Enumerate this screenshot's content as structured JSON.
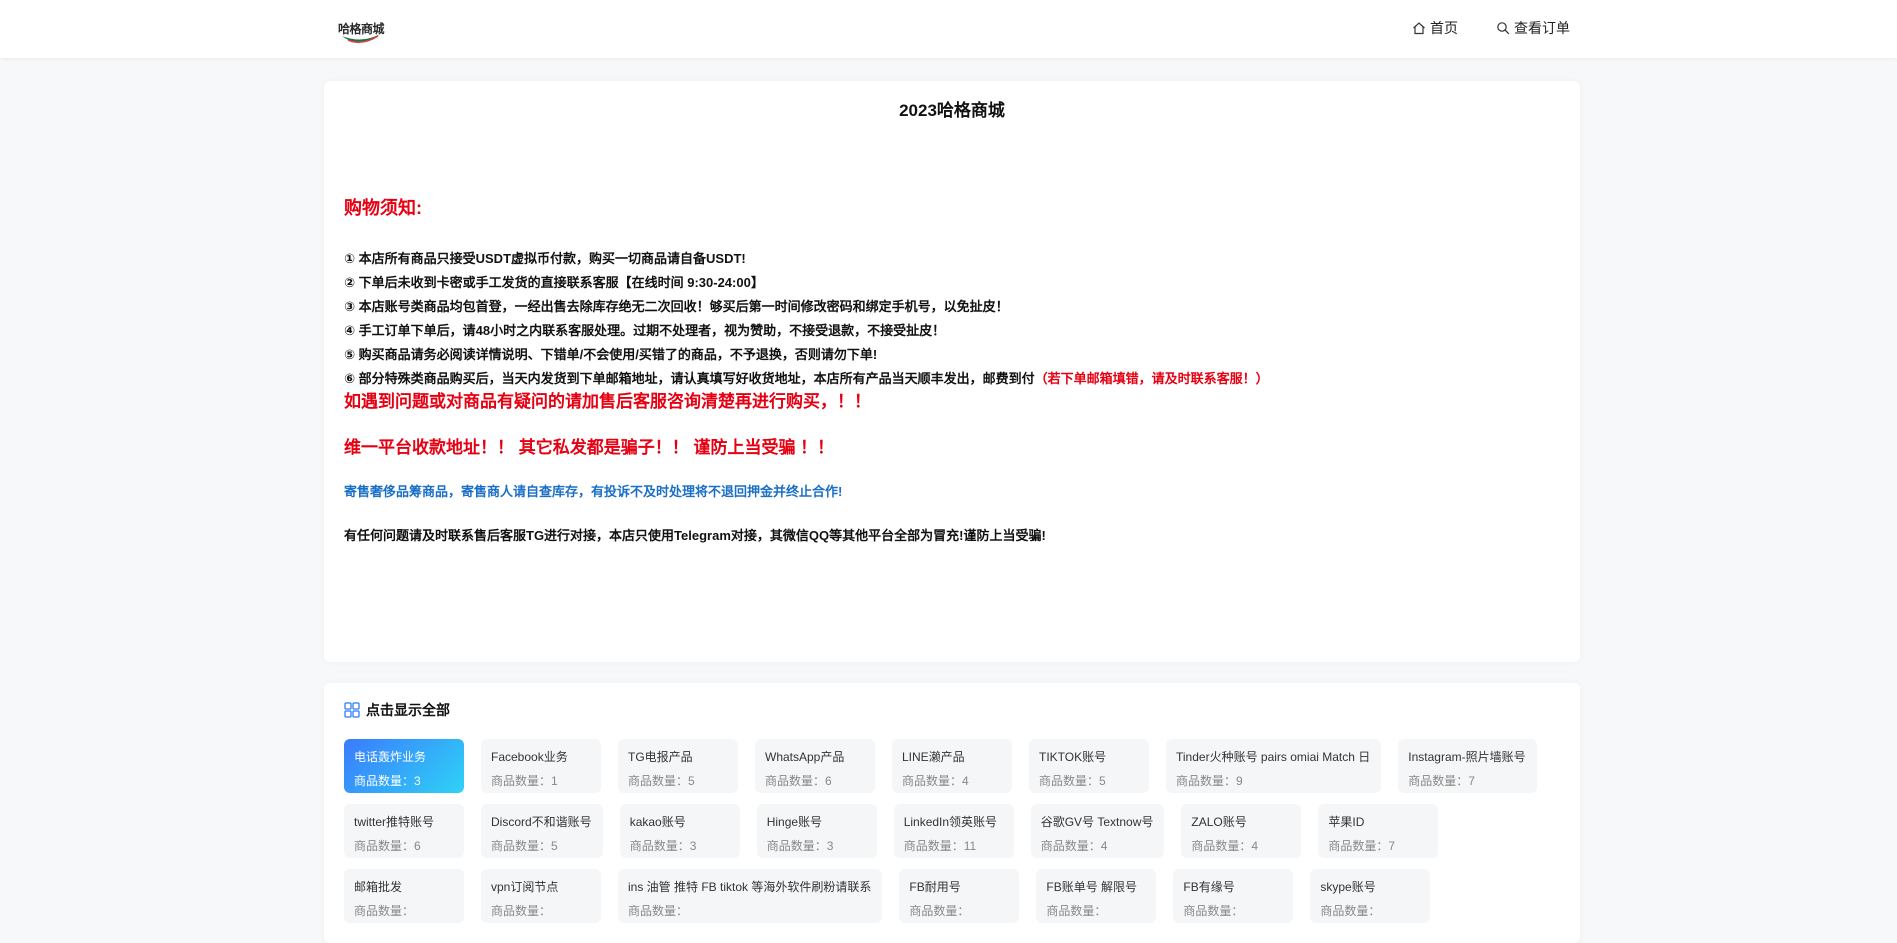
{
  "brand": {
    "logo_text": "哈格商城"
  },
  "nav": [
    {
      "label": "首页",
      "icon": "home-icon"
    },
    {
      "label": "查看订单",
      "icon": "search-icon"
    }
  ],
  "notice": {
    "title": "2023哈格商城",
    "heading": "购物须知:",
    "rules": [
      "① 本店所有商品只接受USDT虚拟币付款，购买一切商品请自备USDT!",
      "② 下单后未收到卡密或手工发货的直接联系客服【在线时间 9:30-24:00】",
      "③  本店账号类商品均包首登，一经出售去除库存绝无二次回收！够买后第一时间修改密码和绑定手机号，以免扯皮！",
      "④ 手工订单下单后，请48小时之内联系客服处理。过期不处理者，视为赞助，不接受退款，不接受扯皮！",
      "⑤ 购买商品请务必阅读详情说明、下错单/不会使用/买错了的商品，不予退换，否则请勿下单!"
    ],
    "rule6": "⑥ 部分特殊类商品购买后，当天内发货到下单邮箱地址，请认真填写好收货地址，本店所有产品当天顺丰发出，邮费到付",
    "rule6_red": "（若下单邮箱填错，请及时联系客服！）",
    "warning1": "如遇到问题或对商品有疑问的请加售后客服咨询清楚再进行购买，！！",
    "warning2": "维一平台收款地址！！ 其它私发都是骗子！！ 谨防上当受骗 ！！",
    "blue_note": "寄售奢侈品筹商品，寄售商人请自查库存，有投诉不及时处理将不退回押金并终止合作!",
    "black_note": "有任何问题请及时联系售后客服TG进行对接，本店只使用Telegram对接，其微信QQ等其他平台全部为冒充!谨防上当受骗!"
  },
  "categories": {
    "header": "点击显示全部",
    "count_prefix": "商品数量：",
    "items": [
      {
        "name": "电话轰炸业务",
        "count": "3",
        "active": true
      },
      {
        "name": "Facebook业务",
        "count": "1"
      },
      {
        "name": "TG电报产品",
        "count": "5"
      },
      {
        "name": "WhatsApp产品",
        "count": "6"
      },
      {
        "name": "LINE濑产品",
        "count": "4"
      },
      {
        "name": "TIKTOK账号",
        "count": "5"
      },
      {
        "name": "Tinder火种账号 pairs omiai Match 日",
        "count": "9"
      },
      {
        "name": "Instagram-照片墙账号",
        "count": "7"
      },
      {
        "name": "twitter推特账号",
        "count": "6"
      },
      {
        "name": "Discord不和谐账号",
        "count": "5"
      },
      {
        "name": "kakao账号",
        "count": "3"
      },
      {
        "name": "Hinge账号",
        "count": "3"
      },
      {
        "name": "LinkedIn领英账号",
        "count": "11"
      },
      {
        "name": "谷歌GV号 Textnow号",
        "count": "4"
      },
      {
        "name": "ZALO账号",
        "count": "4"
      },
      {
        "name": "苹果ID",
        "count": "7"
      },
      {
        "name": "邮箱批发",
        "count": ""
      },
      {
        "name": "vpn订阅节点",
        "count": ""
      },
      {
        "name": "ins 油管 推特 FB tiktok 等海外软件刷粉请联系",
        "count": ""
      },
      {
        "name": "FB耐用号",
        "count": ""
      },
      {
        "name": "FB账单号 解限号",
        "count": ""
      },
      {
        "name": "FB有缘号",
        "count": ""
      },
      {
        "name": "skype账号",
        "count": ""
      }
    ]
  }
}
